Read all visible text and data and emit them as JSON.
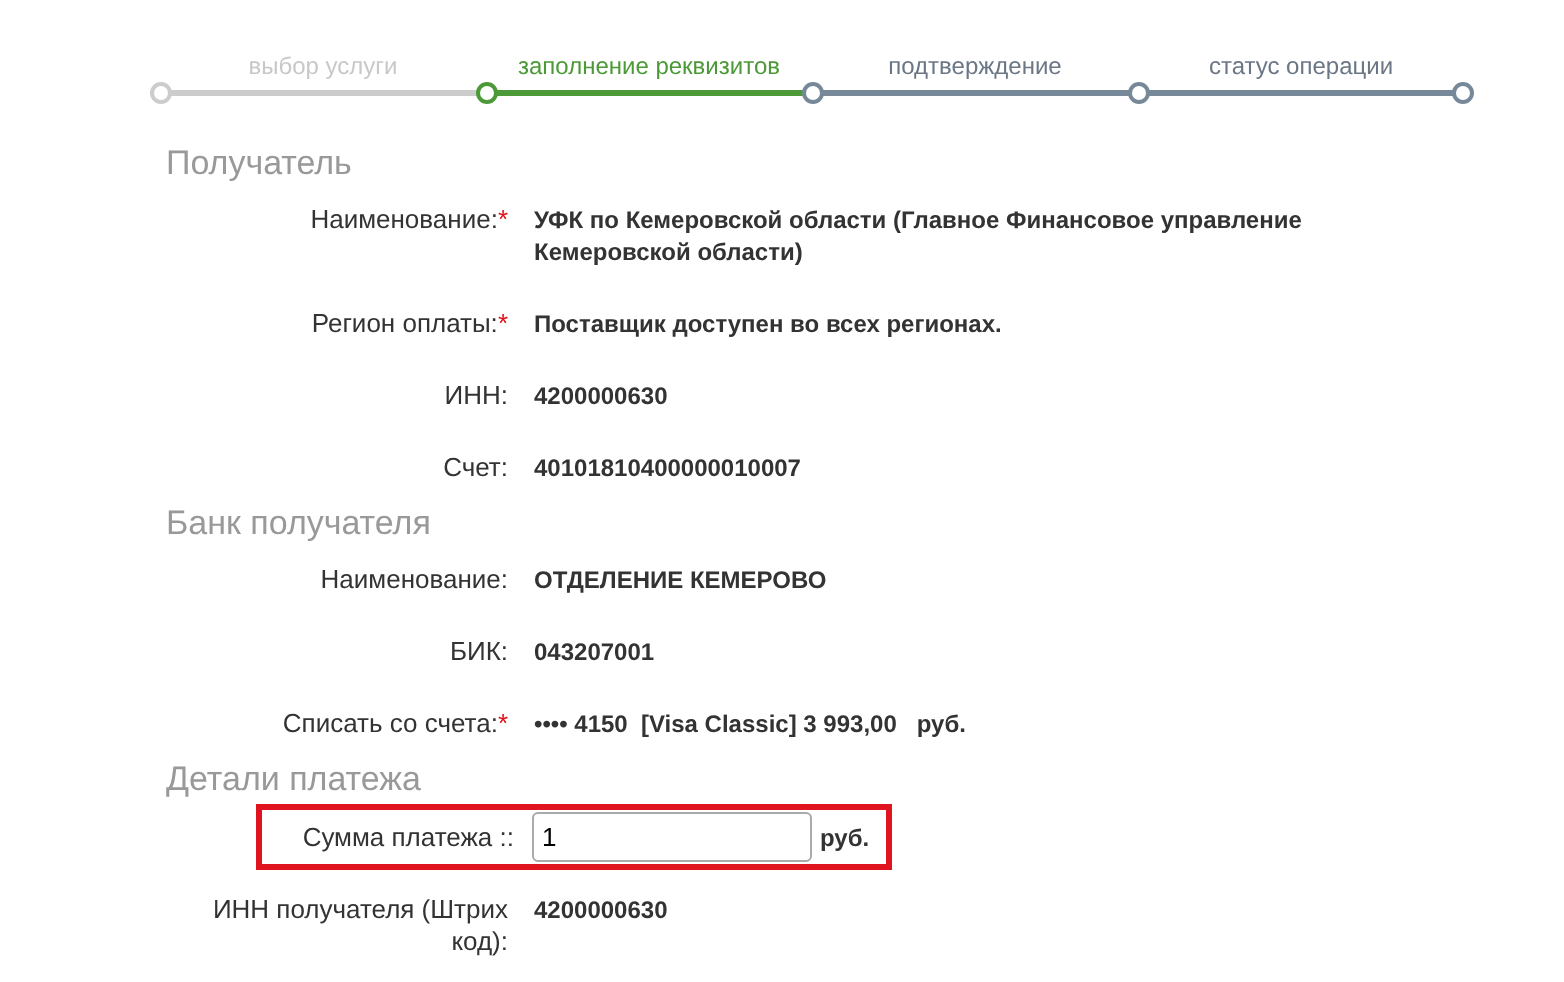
{
  "steps": [
    {
      "label": "выбор услуги",
      "completed": true,
      "selected": false
    },
    {
      "label": "заполнение реквизитов",
      "completed": false,
      "selected": true
    },
    {
      "label": "подтверждение",
      "completed": false,
      "selected": false
    },
    {
      "label": "статус операции",
      "completed": false,
      "selected": false
    }
  ],
  "sections": [
    {
      "title": "Получатель",
      "rows": [
        {
          "kind": "text",
          "label": "Наименование:",
          "required_mark": "*",
          "value": "УФК по Кемеровской области (Главное Финансовое управление Кемеровской области)"
        },
        {
          "kind": "text",
          "label": "Регион оплаты:",
          "required_mark": "*",
          "value": "Поставщик доступен во всех регионах."
        },
        {
          "kind": "text",
          "label": "ИНН:",
          "value": "4200000630"
        },
        {
          "kind": "text",
          "label": "Счет:",
          "value": "40101810400000010007"
        }
      ]
    },
    {
      "title": "Банк получателя",
      "rows": [
        {
          "kind": "text",
          "label": "Наименование:",
          "value": "ОТДЕЛЕНИЕ КЕМЕРОВО"
        },
        {
          "kind": "text",
          "label": "БИК:",
          "value": "043207001"
        },
        {
          "kind": "text",
          "label": "Списать со счета:",
          "required_mark": "*",
          "value": "•••• 4150  [Visa Classic] 3 993,00   руб."
        }
      ]
    },
    {
      "title": "Детали платежа",
      "rows": [
        {
          "kind": "input",
          "label": "Сумма платежа ::",
          "value": "1",
          "unit": "руб.",
          "highlighted": true
        },
        {
          "kind": "text",
          "label": "ИНН получателя (Штрих код):",
          "value": "4200000630"
        }
      ]
    }
  ]
}
